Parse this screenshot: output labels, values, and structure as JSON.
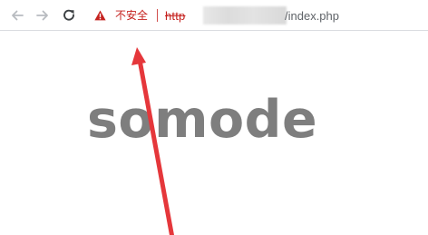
{
  "browser": {
    "nav": {
      "back_icon": "arrow-left-icon",
      "forward_icon": "arrow-right-icon",
      "reload_icon": "reload-icon"
    },
    "address_bar": {
      "security_icon": "warning-triangle-icon",
      "security_label": "不安全",
      "url_scheme": "http",
      "url_path": "/index.php"
    }
  },
  "page": {
    "title": "somode"
  },
  "annotation": {
    "type": "arrow",
    "color": "#e5373b"
  },
  "colors": {
    "insecure_red": "#c5221f",
    "title_gray": "#7e7e7e",
    "icon_gray": "#5f6368"
  }
}
